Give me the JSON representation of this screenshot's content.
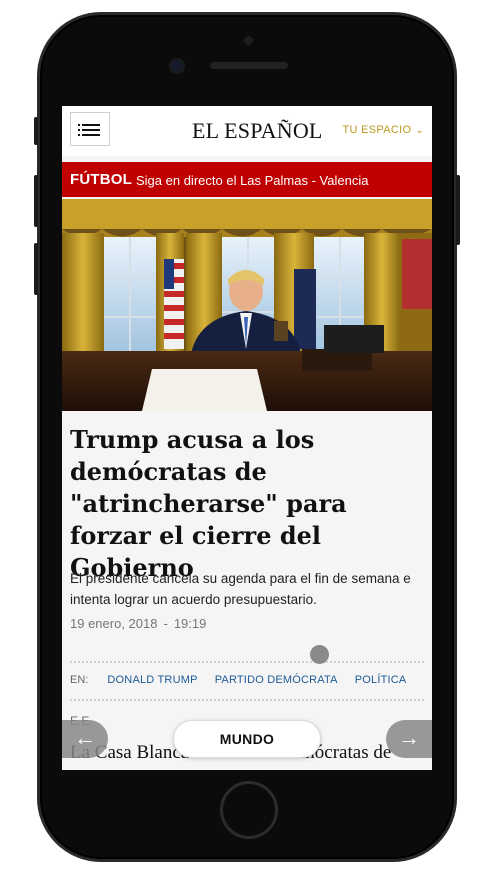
{
  "header": {
    "logo": "EL ESPAÑOL",
    "tu_espacio": "TU ESPACIO",
    "tu_espacio_icon": "chevron-down-icon",
    "menu_icon": "hamburger-menu-icon"
  },
  "live_bar": {
    "tag": "FÚTBOL",
    "text": "Siga en directo el Las Palmas - Valencia",
    "color": "#c00000"
  },
  "article": {
    "headline": "Trump acusa a los demócratas de \"atrincherarse\" para forzar el cierre del Gobierno",
    "subhead": "El presidente cancela su agenda para el fin de semana e intenta lograr un acuerdo presupuestario.",
    "date": "19 enero, 2018",
    "separator": "-",
    "time": "19:19",
    "tags_label": "EN:",
    "tags": [
      "DONALD TRUMP",
      "PARTIDO DEMÓCRATA",
      "POLÍTICA"
    ],
    "byline": "E.E.",
    "body_start": "La Casa Blanca acusó a los demócratas de"
  },
  "bottom_nav": {
    "section": "MUNDO",
    "prev_icon": "arrow-left-icon",
    "next_icon": "arrow-right-icon"
  },
  "colors": {
    "accent_gold": "#b8981d",
    "tag_link": "#1e5a96",
    "live_red": "#c00000"
  }
}
